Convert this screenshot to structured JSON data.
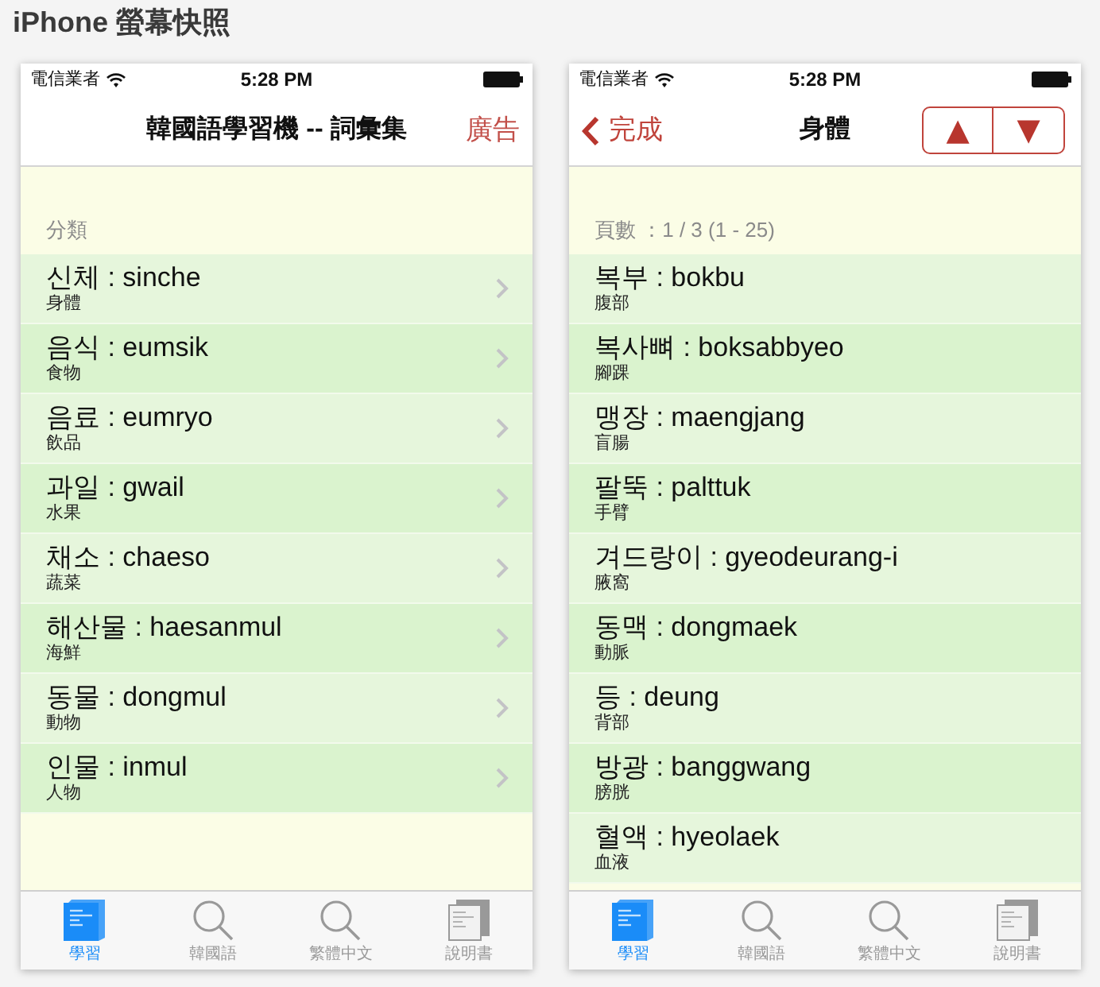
{
  "page_title": "iPhone 螢幕快照",
  "screens": [
    {
      "status_bar": {
        "carrier": "電信業者",
        "time": "5:28 PM"
      },
      "nav_bar": {
        "title": "韓國語學習機 -- 詞彙集",
        "right_button": "廣告"
      },
      "list_header": "分類",
      "rows": [
        {
          "korean": "신체 : sinche",
          "chinese": "身體",
          "chevron": true
        },
        {
          "korean": "음식 : eumsik",
          "chinese": "食物",
          "chevron": true
        },
        {
          "korean": "음료 : eumryo",
          "chinese": "飲品",
          "chevron": true
        },
        {
          "korean": "과일 : gwail",
          "chinese": "水果",
          "chevron": true
        },
        {
          "korean": "채소 : chaeso",
          "chinese": "蔬菜",
          "chevron": true
        },
        {
          "korean": "해산물 : haesanmul",
          "chinese": "海鮮",
          "chevron": true
        },
        {
          "korean": "동물 : dongmul",
          "chinese": "動物",
          "chevron": true
        },
        {
          "korean": "인물 : inmul",
          "chinese": "人物",
          "chevron": true
        }
      ],
      "tab_bar": [
        {
          "kind": "study",
          "label": "學習",
          "selected": true
        },
        {
          "kind": "search",
          "label": "韓國語",
          "selected": false
        },
        {
          "kind": "search",
          "label": "繁體中文",
          "selected": false
        },
        {
          "kind": "manual",
          "label": "說明書",
          "selected": false
        }
      ]
    },
    {
      "status_bar": {
        "carrier": "電信業者",
        "time": "5:28 PM"
      },
      "nav_bar": {
        "back_button": "完成",
        "title": "身體",
        "stepper": [
          "▲",
          "▼"
        ]
      },
      "list_header": "頁數 ：1 / 3 (1 - 25)",
      "rows": [
        {
          "korean": "복부 : bokbu",
          "chinese": "腹部"
        },
        {
          "korean": "복사뼈 : boksabbyeo",
          "chinese": "腳踝"
        },
        {
          "korean": "맹장 : maengjang",
          "chinese": "盲腸"
        },
        {
          "korean": "팔뚝 : palttuk",
          "chinese": "手臂"
        },
        {
          "korean": "겨드랑이 : gyeodeurang-i",
          "chinese": "腋窩"
        },
        {
          "korean": "동맥 : dongmaek",
          "chinese": "動脈"
        },
        {
          "korean": "등 : deung",
          "chinese": "背部"
        },
        {
          "korean": "방광 : banggwang",
          "chinese": "膀胱"
        },
        {
          "korean": "혈액 : hyeolaek",
          "chinese": "血液"
        }
      ],
      "tab_bar": [
        {
          "kind": "study",
          "label": "學習",
          "selected": true
        },
        {
          "kind": "search",
          "label": "韓國語",
          "selected": false
        },
        {
          "kind": "search",
          "label": "繁體中文",
          "selected": false
        },
        {
          "kind": "manual",
          "label": "說明書",
          "selected": false
        }
      ]
    }
  ]
}
